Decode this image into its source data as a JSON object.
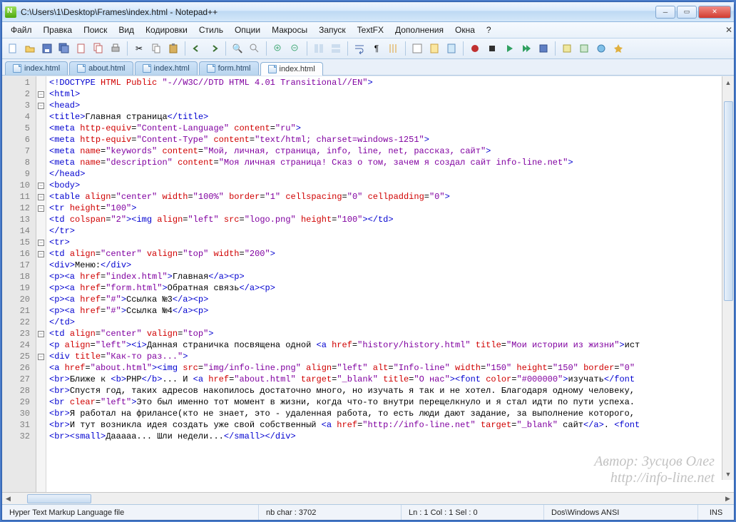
{
  "window": {
    "title": "C:\\Users\\1\\Desktop\\Frames\\index.html - Notepad++"
  },
  "menu": {
    "items": [
      "Файл",
      "Правка",
      "Поиск",
      "Вид",
      "Кодировки",
      "Стиль",
      "Опции",
      "Макросы",
      "Запуск",
      "TextFX",
      "Дополнения",
      "Окна",
      "?"
    ]
  },
  "tabs": [
    {
      "label": "index.html",
      "active": false
    },
    {
      "label": "about.html",
      "active": false
    },
    {
      "label": "index.html",
      "active": false
    },
    {
      "label": "form.html",
      "active": false
    },
    {
      "label": "index.html",
      "active": true
    }
  ],
  "status": {
    "filetype": "Hyper Text Markup Language file",
    "nbchar": "nb char : 3702",
    "pos": "Ln : 1   Col : 1   Sel : 0",
    "enc": "Dos\\Windows  ANSI",
    "mode": "INS"
  },
  "watermark": {
    "line1": "Автор: Зусцов Олег",
    "line2": "http://info-line.net"
  },
  "code_lines": [
    {
      "n": 1,
      "fold": "",
      "html": "<span class='tag'>&lt;!DOCTYPE</span> <span class='attr'>HTML Public</span> <span class='str'>\"-//W3C//DTD HTML 4.01 Transitional//EN\"</span><span class='tag'>&gt;</span>"
    },
    {
      "n": 2,
      "fold": "-",
      "html": "<span class='tag'>&lt;html&gt;</span>"
    },
    {
      "n": 3,
      "fold": "-",
      "html": "<span class='tag'>&lt;head&gt;</span>"
    },
    {
      "n": 4,
      "fold": "",
      "html": "<span class='tag'>&lt;title&gt;</span><span class='txt'>Главная страница</span><span class='tag'>&lt;/title&gt;</span>"
    },
    {
      "n": 5,
      "fold": "",
      "html": "<span class='tag'>&lt;meta</span> <span class='attr'>http-equiv</span>=<span class='str'>\"Content-Language\"</span> <span class='attr'>content</span>=<span class='str'>\"ru\"</span><span class='tag'>&gt;</span>"
    },
    {
      "n": 6,
      "fold": "",
      "html": "<span class='tag'>&lt;meta</span> <span class='attr'>http-equiv</span>=<span class='str'>\"Content-Type\"</span> <span class='attr'>content</span>=<span class='str'>\"text/html; charset=windows-1251\"</span><span class='tag'>&gt;</span>"
    },
    {
      "n": 7,
      "fold": "",
      "html": "<span class='tag'>&lt;meta</span> <span class='attr'>name</span>=<span class='str'>\"keywords\"</span> <span class='attr'>content</span>=<span class='str'>\"Мой, личная, страница, info, line, net, рассказ, сайт\"</span><span class='tag'>&gt;</span>"
    },
    {
      "n": 8,
      "fold": "",
      "html": "<span class='tag'>&lt;meta</span> <span class='attr'>name</span>=<span class='str'>\"description\"</span> <span class='attr'>content</span>=<span class='str'>\"Моя личная страница! Сказ о том, зачем я создал сайт info-line.net\"</span><span class='tag'>&gt;</span>"
    },
    {
      "n": 9,
      "fold": "",
      "html": "<span class='tag'>&lt;/head&gt;</span>"
    },
    {
      "n": 10,
      "fold": "-",
      "html": "<span class='tag'>&lt;body&gt;</span>"
    },
    {
      "n": 11,
      "fold": "-",
      "html": "<span class='tag'>&lt;table</span> <span class='attr'>align</span>=<span class='str'>\"center\"</span> <span class='attr'>width</span>=<span class='str'>\"100%\"</span> <span class='attr'>border</span>=<span class='str'>\"1\"</span> <span class='attr'>cellspacing</span>=<span class='str'>\"0\"</span> <span class='attr'>cellpadding</span>=<span class='str'>\"0\"</span><span class='tag'>&gt;</span>"
    },
    {
      "n": 12,
      "fold": "-",
      "html": "<span class='tag'>&lt;tr</span> <span class='attr'>height</span>=<span class='str'>\"100\"</span><span class='tag'>&gt;</span>"
    },
    {
      "n": 13,
      "fold": "",
      "html": "<span class='tag'>&lt;td</span> <span class='attr'>colspan</span>=<span class='str'>\"2\"</span><span class='tag'>&gt;&lt;img</span> <span class='attr'>align</span>=<span class='str'>\"left\"</span> <span class='attr'>src</span>=<span class='str'>\"logo.png\"</span> <span class='attr'>height</span>=<span class='str'>\"100\"</span><span class='tag'>&gt;&lt;/td&gt;</span>"
    },
    {
      "n": 14,
      "fold": "",
      "html": "<span class='tag'>&lt;/tr&gt;</span>"
    },
    {
      "n": 15,
      "fold": "-",
      "html": "<span class='tag'>&lt;tr&gt;</span>"
    },
    {
      "n": 16,
      "fold": "-",
      "html": "<span class='tag'>&lt;td</span> <span class='attr'>align</span>=<span class='str'>\"center\"</span> <span class='attr'>valign</span>=<span class='str'>\"top\"</span> <span class='attr'>width</span>=<span class='str'>\"200\"</span><span class='tag'>&gt;</span>"
    },
    {
      "n": 17,
      "fold": "",
      "html": "<span class='tag'>&lt;div&gt;</span><span class='txt'>Меню:</span><span class='tag'>&lt;/div&gt;</span>"
    },
    {
      "n": 18,
      "fold": "",
      "html": "<span class='tag'>&lt;p&gt;&lt;a</span> <span class='attr'>href</span>=<span class='str'>\"index.html\"</span><span class='tag'>&gt;</span><span class='txt'>Главная</span><span class='tag'>&lt;/a&gt;&lt;p&gt;</span>"
    },
    {
      "n": 19,
      "fold": "",
      "html": "<span class='tag'>&lt;p&gt;&lt;a</span> <span class='attr'>href</span>=<span class='str'>\"form.html\"</span><span class='tag'>&gt;</span><span class='txt'>Обратная связь</span><span class='tag'>&lt;/a&gt;&lt;p&gt;</span>"
    },
    {
      "n": 20,
      "fold": "",
      "html": "<span class='tag'>&lt;p&gt;&lt;a</span> <span class='attr'>href</span>=<span class='str'>\"#\"</span><span class='tag'>&gt;</span><span class='txt'>Ссылка №3</span><span class='tag'>&lt;/a&gt;&lt;p&gt;</span>"
    },
    {
      "n": 21,
      "fold": "",
      "html": "<span class='tag'>&lt;p&gt;&lt;a</span> <span class='attr'>href</span>=<span class='str'>\"#\"</span><span class='tag'>&gt;</span><span class='txt'>Ссылка №4</span><span class='tag'>&lt;/a&gt;&lt;p&gt;</span>"
    },
    {
      "n": 22,
      "fold": "",
      "html": "<span class='tag'>&lt;/td&gt;</span>"
    },
    {
      "n": 23,
      "fold": "-",
      "html": "<span class='tag'>&lt;td</span> <span class='attr'>align</span>=<span class='str'>\"center\"</span> <span class='attr'>valign</span>=<span class='str'>\"top\"</span><span class='tag'>&gt;</span>"
    },
    {
      "n": 24,
      "fold": "",
      "html": "<span class='tag'>&lt;p</span> <span class='attr'>align</span>=<span class='str'>\"left\"</span><span class='tag'>&gt;&lt;i&gt;</span><span class='txt'>Данная страничка посвящена одной </span><span class='tag'>&lt;a</span> <span class='attr'>href</span>=<span class='str'>\"history/history.html\"</span> <span class='attr'>title</span>=<span class='str'>\"Мои истории из жизни\"</span><span class='tag'>&gt;</span><span class='txt'>ист</span>"
    },
    {
      "n": 25,
      "fold": "-",
      "html": "<span class='tag'>&lt;div</span> <span class='attr'>title</span>=<span class='str'>\"Как-то раз...\"</span><span class='tag'>&gt;</span>"
    },
    {
      "n": 26,
      "fold": "",
      "html": "<span class='tag'>&lt;a</span> <span class='attr'>href</span>=<span class='str'>\"about.html\"</span><span class='tag'>&gt;&lt;img</span> <span class='attr'>src</span>=<span class='str'>\"img/info-line.png\"</span> <span class='attr'>align</span>=<span class='str'>\"left\"</span> <span class='attr'>alt</span>=<span class='str'>\"Info-line\"</span> <span class='attr'>width</span>=<span class='str'>\"150\"</span> <span class='attr'>height</span>=<span class='str'>\"150\"</span> <span class='attr'>border</span>=<span class='str'>\"0\"</span>"
    },
    {
      "n": 27,
      "fold": "",
      "html": "<span class='tag'>&lt;br&gt;</span><span class='txt'>Ближе к </span><span class='tag'>&lt;b&gt;</span><span class='txt'>PHP</span><span class='tag'>&lt;/b&gt;</span><span class='txt'>... И </span><span class='tag'>&lt;a</span> <span class='attr'>href</span>=<span class='str'>\"about.html\"</span> <span class='attr'>target</span>=<span class='str'>\"_blank\"</span> <span class='attr'>title</span>=<span class='str'>\"О нас\"</span><span class='tag'>&gt;&lt;font</span> <span class='attr'>color</span>=<span class='str'>\"#000000\"</span><span class='tag'>&gt;</span><span class='txt'>изучать</span><span class='tag'>&lt;/font</span>"
    },
    {
      "n": 28,
      "fold": "",
      "html": "<span class='tag'>&lt;br&gt;</span><span class='txt'>Спустя год, таких адресов накопилось достаточно много, но изучать я так и не хотел. Благодаря одному человеку,</span>"
    },
    {
      "n": 29,
      "fold": "",
      "html": "<span class='tag'>&lt;br</span> <span class='attr'>clear</span>=<span class='str'>\"left\"</span><span class='tag'>&gt;</span><span class='txt'>Это был именно тот момент в жизни, когда что-то внутри перещелкнуло и я стал идти по пути успеха.</span>"
    },
    {
      "n": 30,
      "fold": "",
      "html": "<span class='tag'>&lt;br&gt;</span><span class='txt'>Я работал на фрилансе(кто не знает, это - удаленная работа, то есть люди дают задание, за выполнение которого,</span>"
    },
    {
      "n": 31,
      "fold": "",
      "html": "<span class='tag'>&lt;br&gt;</span><span class='txt'>И тут возникла идея создать уже свой собственный </span><span class='tag'>&lt;a</span> <span class='attr'>href</span>=<span class='str'>\"http://info-line.net\"</span> <span class='attr'>target</span>=<span class='str'>\"_blank\"</span> <span class='txt'>сайт</span><span class='tag'>&lt;/a&gt;</span><span class='txt'>. </span><span class='tag'>&lt;font</span>"
    },
    {
      "n": 32,
      "fold": "",
      "html": "<span class='tag'>&lt;br&gt;&lt;small&gt;</span><span class='txt'>Дааааа... Шли недели...</span><span class='tag'>&lt;/small&gt;&lt;/div&gt;</span>"
    }
  ]
}
